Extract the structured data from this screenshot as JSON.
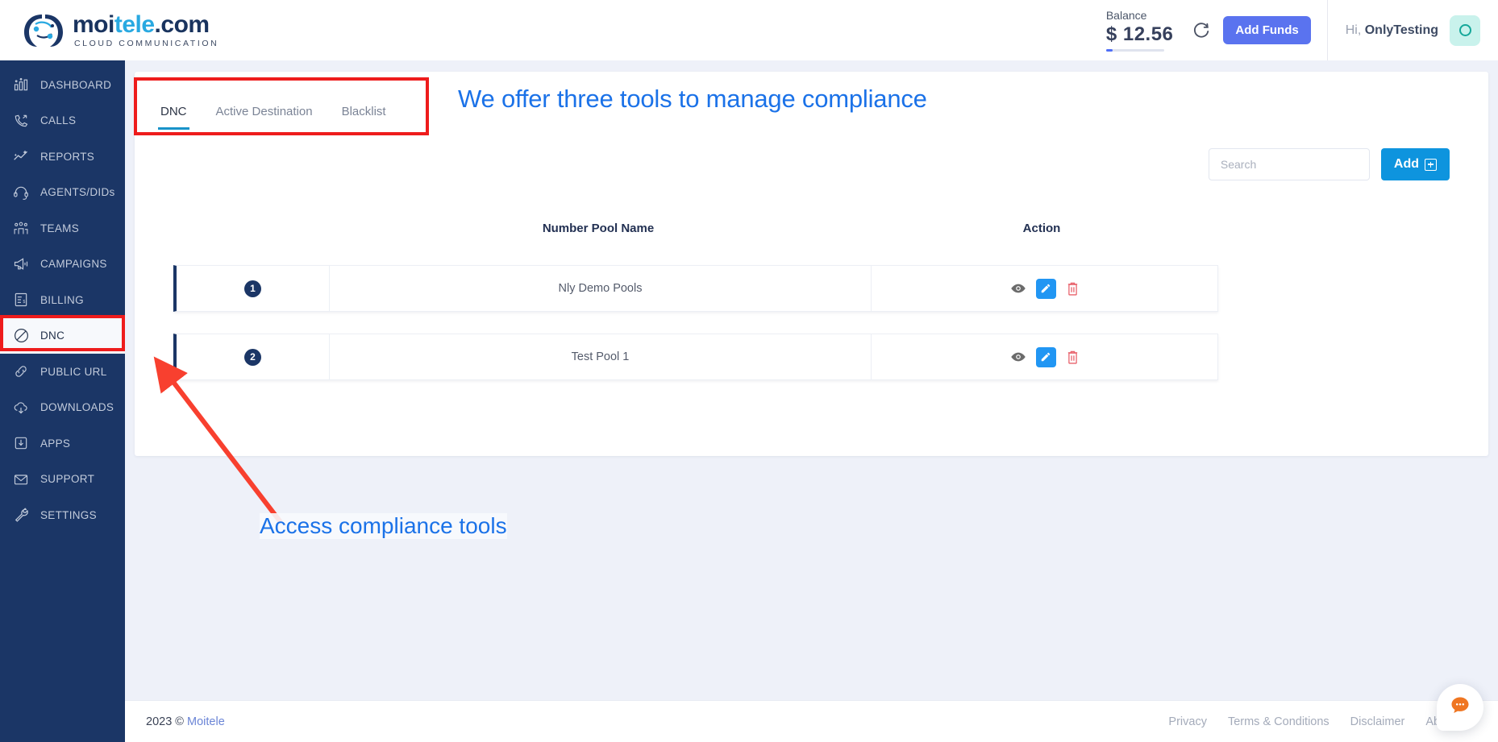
{
  "brand": {
    "name_dark_1": "moi",
    "name_cyan": "tele",
    "name_dark_2": ".com",
    "tagline": "CLOUD COMMUNICATION",
    "logo_icon": "headset-network-icon"
  },
  "header": {
    "balance_label": "Balance",
    "balance_amount": "$ 12.56",
    "refresh_icon": "refresh-icon",
    "add_funds_label": "Add Funds",
    "greeting_prefix": "Hi, ",
    "username": "OnlyTesting",
    "avatar_icon": "user-circle-icon"
  },
  "sidebar": {
    "items": [
      {
        "label": "DASHBOARD",
        "icon": "chart-bars-icon",
        "active": false
      },
      {
        "label": "CALLS",
        "icon": "phone-icon",
        "active": false
      },
      {
        "label": "REPORTS",
        "icon": "trending-up-icon",
        "active": false
      },
      {
        "label": "AGENTS/DIDs",
        "icon": "headset-icon",
        "active": false
      },
      {
        "label": "TEAMS",
        "icon": "people-icon",
        "active": false
      },
      {
        "label": "CAMPAIGNS",
        "icon": "megaphone-icon",
        "active": false
      },
      {
        "label": "BILLING",
        "icon": "invoice-icon",
        "active": false
      },
      {
        "label": "DNC",
        "icon": "no-entry-icon",
        "active": true
      },
      {
        "label": "PUBLIC URL",
        "icon": "link-icon",
        "active": false
      },
      {
        "label": "DOWNLOADS",
        "icon": "cloud-download-icon",
        "active": false
      },
      {
        "label": "APPS",
        "icon": "app-download-icon",
        "active": false
      },
      {
        "label": "SUPPORT",
        "icon": "envelope-icon",
        "active": false
      },
      {
        "label": "SETTINGS",
        "icon": "wrench-icon",
        "active": false
      }
    ]
  },
  "main": {
    "tabs": [
      {
        "label": "DNC",
        "active": true
      },
      {
        "label": "Active Destination",
        "active": false
      },
      {
        "label": "Blacklist",
        "active": false
      }
    ],
    "search": {
      "placeholder": "Search",
      "value": ""
    },
    "add_button": {
      "label": "Add",
      "icon": "plus-square-icon"
    },
    "table": {
      "columns": [
        "",
        "Number Pool Name",
        "Action"
      ],
      "rows": [
        {
          "index": "1",
          "name": "Nly Demo Pools"
        },
        {
          "index": "2",
          "name": "Test Pool 1"
        }
      ],
      "action_icons": [
        "eye-icon",
        "pencil-icon",
        "trash-icon"
      ]
    }
  },
  "annotations": {
    "title": "We offer three tools to manage compliance",
    "label": "Access compliance tools",
    "color": "#1b72e8",
    "box_color": "#ee1c1c"
  },
  "footer": {
    "copyright_year": "2023 ©",
    "copyright_brand": "Moitele",
    "links": [
      "Privacy",
      "Terms & Conditions",
      "Disclaimer",
      "About Us"
    ]
  },
  "chat": {
    "icon": "chat-bubble-icon",
    "color": "#ef7622"
  }
}
